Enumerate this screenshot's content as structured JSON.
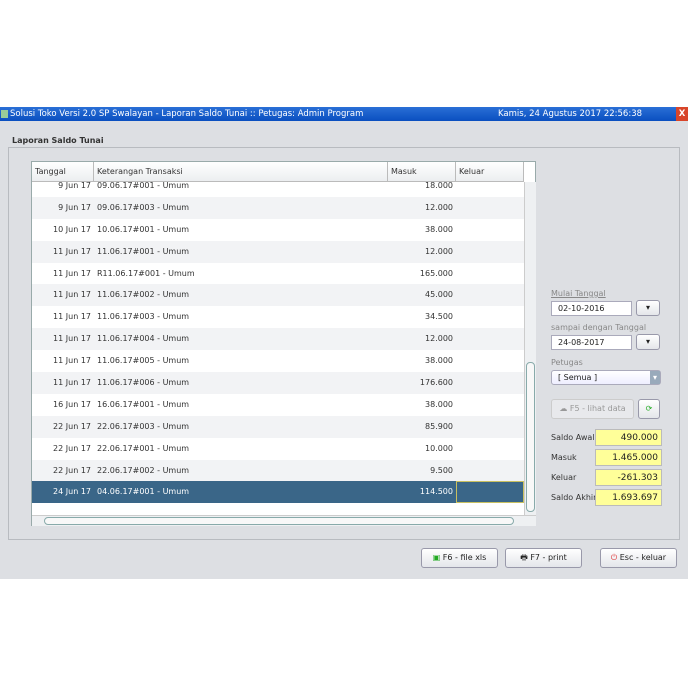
{
  "window": {
    "title": "Solusi Toko Versi 2.0 SP Swalayan   - Laporan  Saldo Tunai  ::  Petugas: Admin Program",
    "datetime": "Kamis, 24 Agustus 2017   22:56:38",
    "close": "X"
  },
  "section_title": "Laporan  Saldo Tunai",
  "table": {
    "columns": [
      "Tanggal",
      "Keterangan Transaksi",
      "Masuk",
      "Keluar"
    ],
    "rows": [
      [
        "9 Jun 17",
        "09.06.17#001 - Umum",
        "18.000",
        ""
      ],
      [
        "9 Jun 17",
        "09.06.17#003 - Umum",
        "12.000",
        ""
      ],
      [
        "10 Jun 17",
        "10.06.17#001 - Umum",
        "38.000",
        ""
      ],
      [
        "11 Jun 17",
        "11.06.17#001 - Umum",
        "12.000",
        ""
      ],
      [
        "11 Jun 17",
        "R11.06.17#001 - Umum",
        "165.000",
        ""
      ],
      [
        "11 Jun 17",
        "11.06.17#002 - Umum",
        "45.000",
        ""
      ],
      [
        "11 Jun 17",
        "11.06.17#003 - Umum",
        "34.500",
        ""
      ],
      [
        "11 Jun 17",
        "11.06.17#004 - Umum",
        "12.000",
        ""
      ],
      [
        "11 Jun 17",
        "11.06.17#005 - Umum",
        "38.000",
        ""
      ],
      [
        "11 Jun 17",
        "11.06.17#006 - Umum",
        "176.600",
        ""
      ],
      [
        "16 Jun 17",
        "16.06.17#001 - Umum",
        "38.000",
        ""
      ],
      [
        "22 Jun 17",
        "22.06.17#003 - Umum",
        "85.900",
        ""
      ],
      [
        "22 Jun 17",
        "22.06.17#001 - Umum",
        "10.000",
        ""
      ],
      [
        "22 Jun 17",
        "22.06.17#002 - Umum",
        "9.500",
        ""
      ],
      [
        "24 Jun 17",
        "04.06.17#001 - Umum",
        "114.500",
        ""
      ]
    ],
    "selected_row": 14
  },
  "filters": {
    "mulai_label": "Mulai Tanggal",
    "mulai_value": "02-10-2016",
    "sampai_label": "sampai dengan Tanggal",
    "sampai_value": "24-08-2017",
    "petugas_label": "Petugas",
    "petugas_value": "[ Semua ]",
    "lihat_label": "F5 - lihat data"
  },
  "summary": [
    {
      "label": "Saldo Awal",
      "value": "490.000"
    },
    {
      "label": "Masuk",
      "value": "1.465.000"
    },
    {
      "label": "Keluar",
      "value": "-261.303"
    },
    {
      "label": "Saldo Akhir",
      "value": "1.693.697"
    }
  ],
  "buttons": {
    "xls": "F6 - file xls",
    "print": "F7 - print",
    "exit": "Esc - keluar"
  },
  "colors": {
    "titlebar": "#0a4fc0",
    "selected_row": "#3a6688",
    "summary_bg": "#ffff99"
  }
}
